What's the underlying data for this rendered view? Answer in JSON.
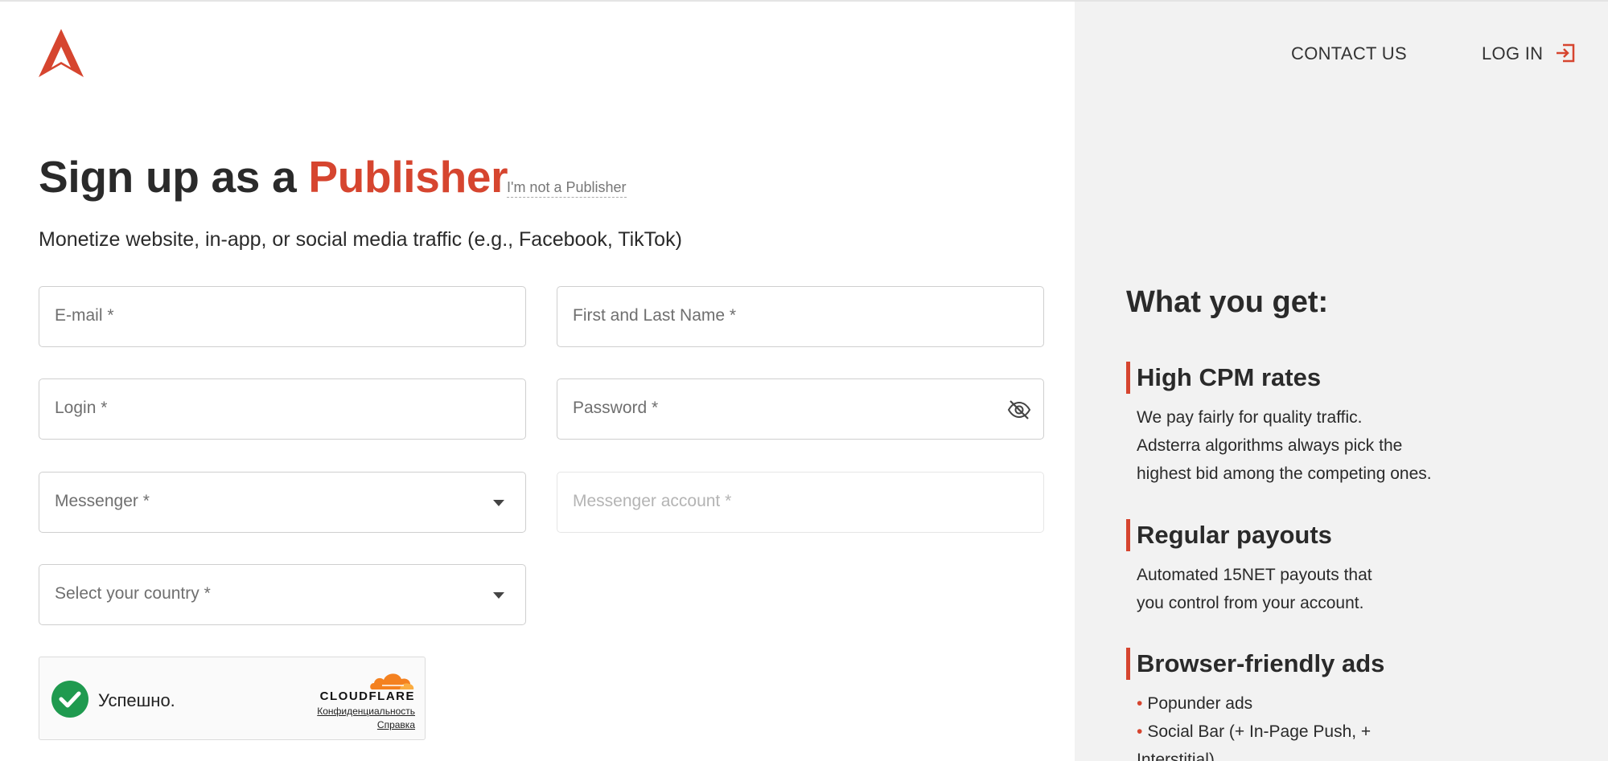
{
  "colors": {
    "accent": "#d6452f",
    "text": "#2a2a2a",
    "panel_bg": "#f2f2f2",
    "cloudflare_orange": "#f48120",
    "success_green": "#1f9a4f"
  },
  "icons": {
    "logo": "adsterra-logo-icon",
    "login": "login-arrow-icon",
    "password_toggle": "eye-slash-icon",
    "dropdown": "chevron-down-icon",
    "captcha_ok": "check-circle-icon",
    "cloudflare": "cloudflare-cloud-icon"
  },
  "nav": {
    "contact": "CONTACT US",
    "login": "LOG IN"
  },
  "hero": {
    "title_prefix": "Sign up as a ",
    "title_accent": "Publisher",
    "switch_link": "I'm not a Publisher",
    "subtitle": "Monetize website, in-app, or social media traffic (e.g., Facebook, TikTok)"
  },
  "form": {
    "email_placeholder": "E-mail *",
    "name_placeholder": "First and Last Name *",
    "login_placeholder": "Login *",
    "password_placeholder": "Password *",
    "messenger_placeholder": "Messenger *",
    "messenger_account_placeholder": "Messenger account *",
    "country_placeholder": "Select your country *"
  },
  "captcha": {
    "status": "Успешно.",
    "brand": "CLOUDFLARE",
    "privacy": "Конфиденциальность",
    "help": "Справка"
  },
  "benefits": {
    "heading": "What you get:",
    "items": [
      {
        "title": "High CPM rates",
        "lines": [
          "We pay fairly for quality traffic.",
          "Adsterra algorithms always pick the",
          "highest bid among the competing ones."
        ]
      },
      {
        "title": "Regular payouts",
        "lines": [
          "Automated 15NET payouts that",
          "you control from your account."
        ]
      },
      {
        "title": "Browser-friendly ads",
        "bullets": [
          "Popunder ads",
          "Social Bar (+ In-Page Push, + Interstitial)"
        ]
      }
    ]
  }
}
